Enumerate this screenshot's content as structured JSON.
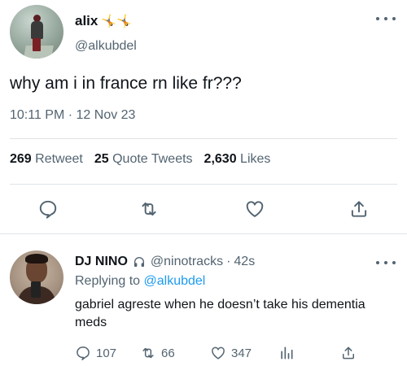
{
  "tweet": {
    "display_name": "alix",
    "badge_icons": [
      "gymnast-icon",
      "gymnast-icon"
    ],
    "badge_glyph": "🤸🤸",
    "handle": "@alkubdel",
    "text": "why am i in france rn like fr???",
    "timestamp": "10:11 PM · 12 Nov 23",
    "stats": {
      "retweets_count": "269",
      "retweets_label": "Retweet",
      "quotes_count": "25",
      "quotes_label": "Quote Tweets",
      "likes_count": "2,630",
      "likes_label": "Likes"
    },
    "actions": [
      "reply-icon",
      "retweet-icon",
      "like-icon",
      "share-icon"
    ]
  },
  "reply": {
    "display_name": "DJ NINO",
    "status_icon": "headphones-icon",
    "handle": "@ninotracks",
    "separator": "·",
    "time": "42s",
    "replying_prefix": "Replying to",
    "replying_to": "@alkubdel",
    "text": "gabriel agreste when he doesn’t take his dementia meds",
    "actions": {
      "replies": "107",
      "retweets": "66",
      "likes": "347"
    }
  },
  "colors": {
    "accent": "#1d9bf0",
    "text_primary": "#0f1419",
    "text_secondary": "#536471",
    "divider": "#dfe4e8"
  }
}
